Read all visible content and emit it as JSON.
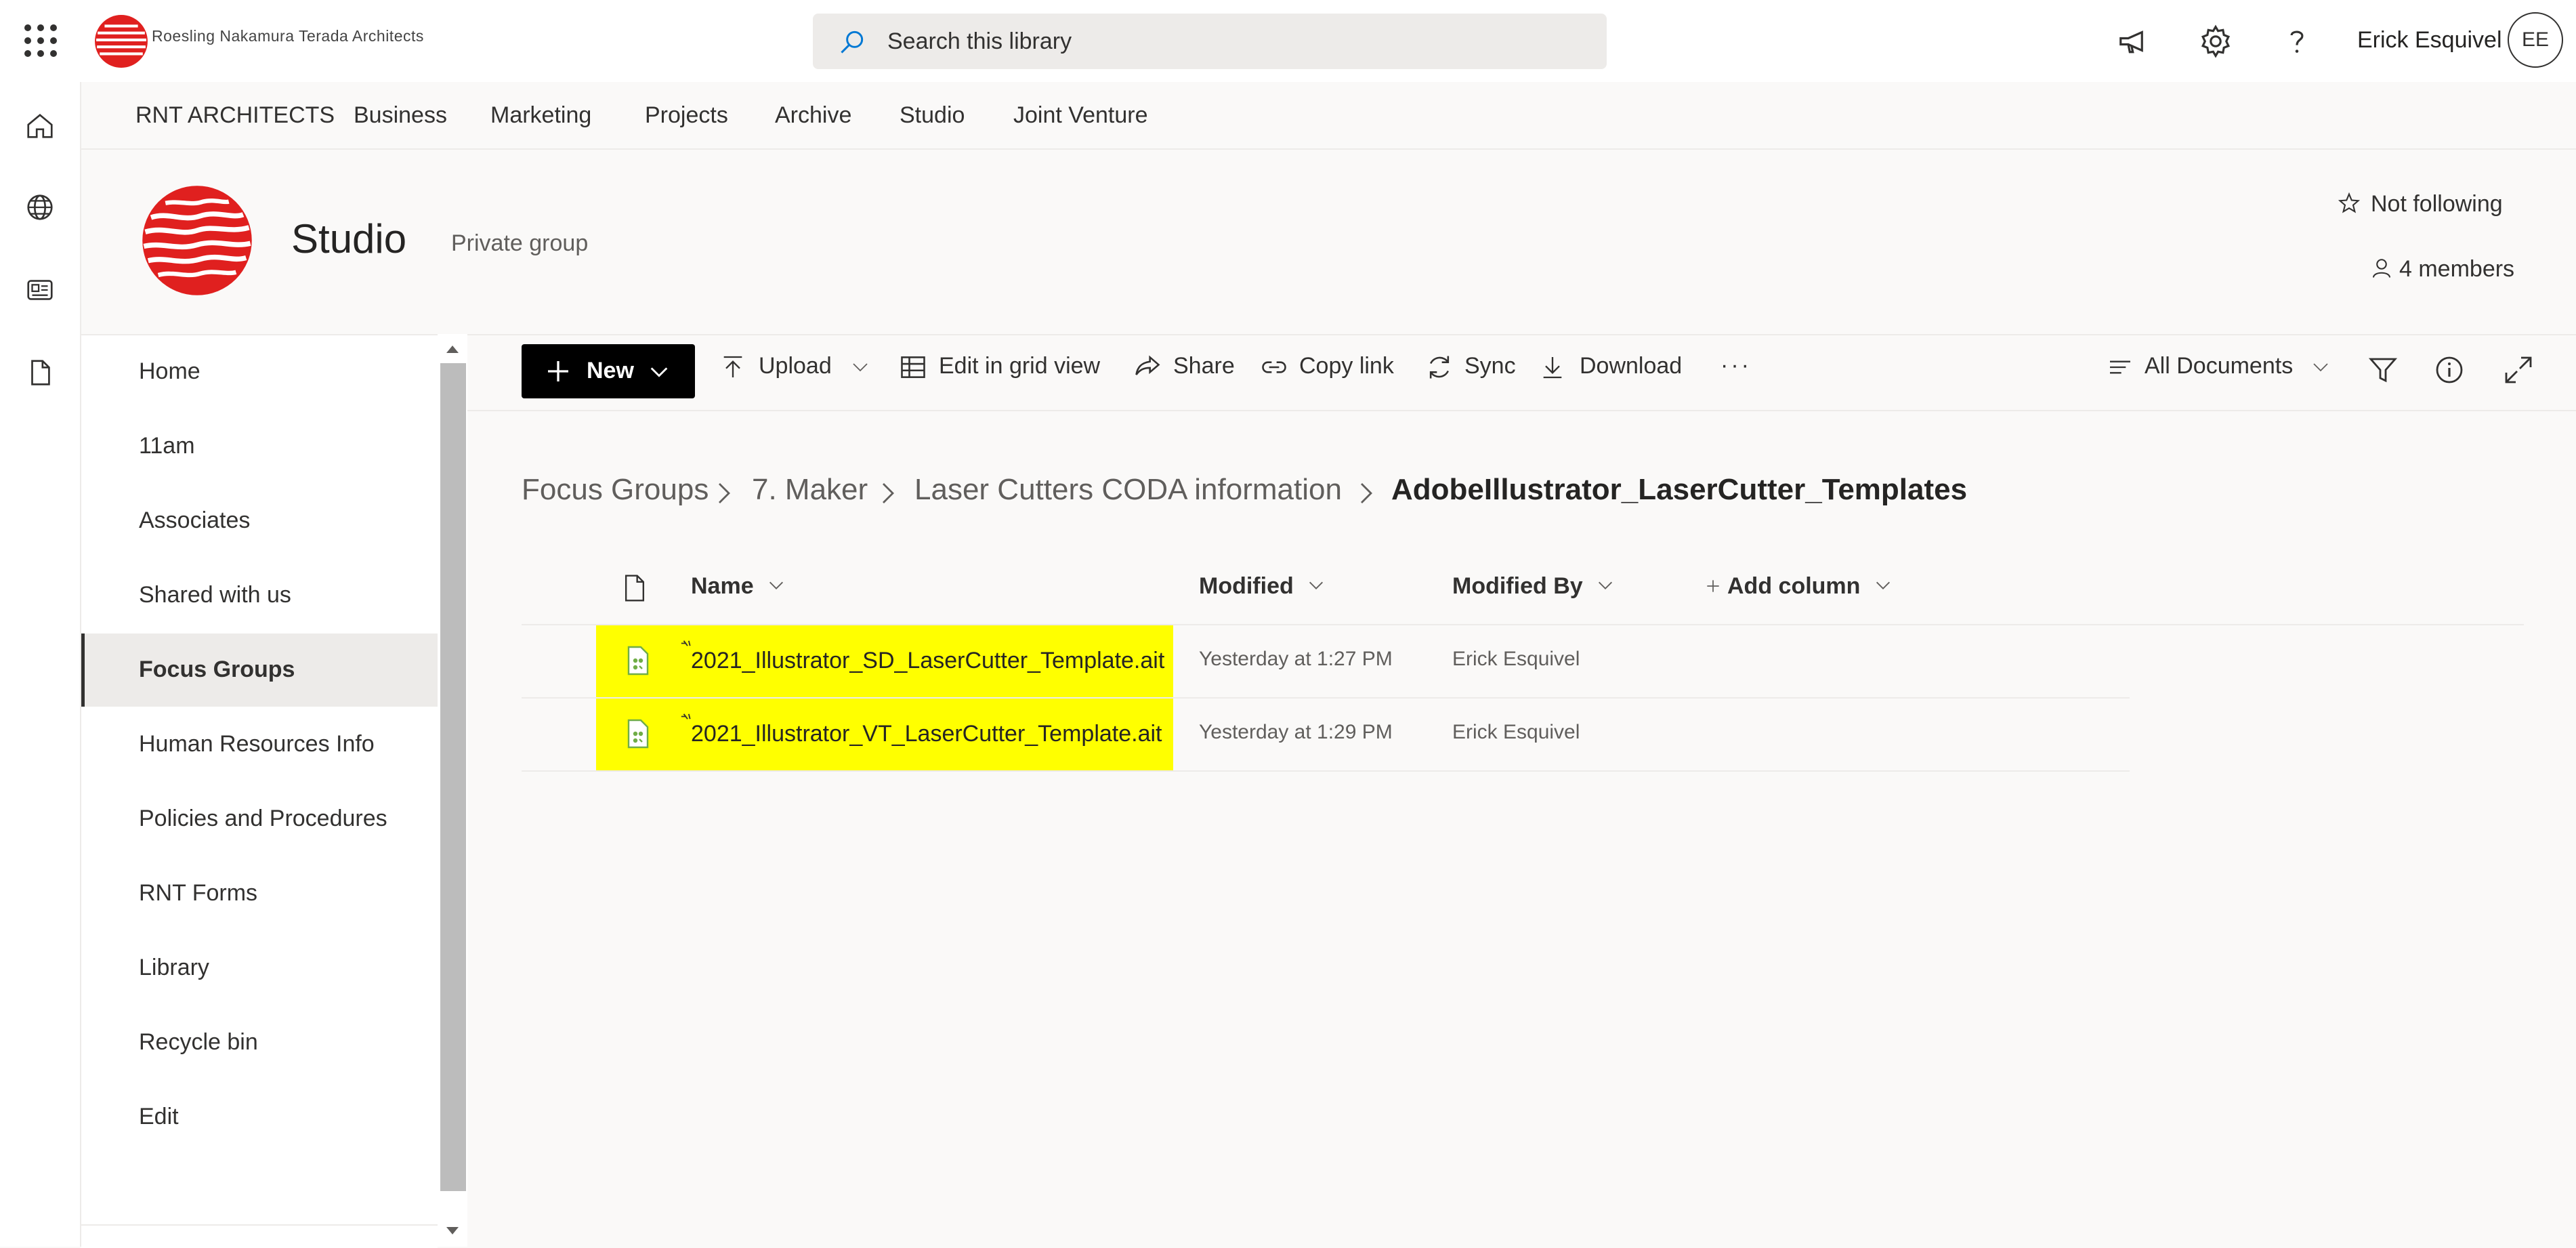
{
  "suite": {
    "brand_name": "Roesling Nakamura Terada Architects",
    "search_placeholder": "Search this library",
    "user_name": "Erick Esquivel",
    "user_initials": "EE"
  },
  "hub_nav": [
    "RNT ARCHITECTS",
    "Business",
    "Marketing",
    "Projects",
    "Archive",
    "Studio",
    "Joint Venture"
  ],
  "site": {
    "title": "Studio",
    "privacy": "Private group",
    "follow_label": "Not following",
    "members_label": "4 members"
  },
  "left_nav": {
    "items": [
      "Home",
      "11am",
      "Associates",
      "Shared with us",
      "Focus Groups",
      "Human Resources Info",
      "Policies and Procedures",
      "RNT Forms",
      "Library",
      "Recycle bin",
      "Edit"
    ],
    "selected": "Focus Groups"
  },
  "command_bar": {
    "new": "New",
    "upload": "Upload",
    "edit_grid": "Edit in grid view",
    "share": "Share",
    "copy_link": "Copy link",
    "sync": "Sync",
    "download": "Download",
    "more": "···",
    "view": "All Documents"
  },
  "breadcrumb": [
    "Focus Groups",
    "7. Maker",
    "Laser Cutters CODA information",
    "AdobeIllustrator_LaserCutter_Templates"
  ],
  "list": {
    "columns": {
      "name": "Name",
      "modified": "Modified",
      "modified_by": "Modified By",
      "add_column": "Add column"
    },
    "rows": [
      {
        "name": "2021_Illustrator_SD_LaserCutter_Template.ait",
        "modified": "Yesterday at 1:27 PM",
        "modified_by": "Erick Esquivel"
      },
      {
        "name": "2021_Illustrator_VT_LaserCutter_Template.ait",
        "modified": "Yesterday at 1:29 PM",
        "modified_by": "Erick Esquivel"
      }
    ]
  },
  "colors": {
    "highlight": "#ffff00",
    "logo_red": "#e0201f",
    "new_button": "#000000"
  }
}
